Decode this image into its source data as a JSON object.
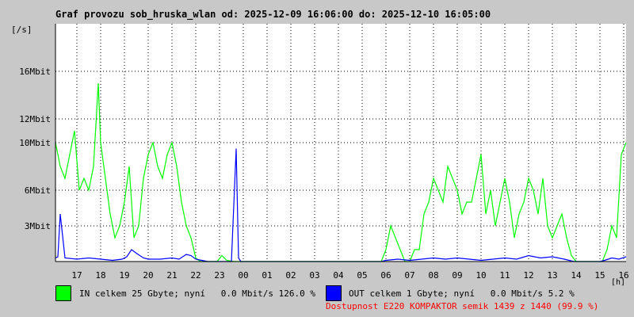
{
  "header": {
    "title": "Graf provozu sob_hruska_wlan od: 2025-12-09 16:06:00 do: 2025-12-10 16:05:00"
  },
  "axis": {
    "y_unit": "[/s]",
    "x_unit": "[h]"
  },
  "legend": {
    "in": {
      "text": "IN celkem 25 Gbyte; nyní   0.0 Mbit/s 126.0 %",
      "color": "#00ff00"
    },
    "out": {
      "text": "OUT celkem 1 Gbyte; nyní   0.0 Mbit/s 5.2 %",
      "color": "#0000ff"
    }
  },
  "availability": {
    "text": "Dostupnost E220 KOMPAKTOR semik 1439 z 1440 (99.9 %)",
    "color": "#ff0000"
  },
  "colors": {
    "plot_bg": "#ffffff",
    "grid": "#000000",
    "in": "#00ff00",
    "out": "#0000ff"
  },
  "chart_data": {
    "type": "line",
    "title": "Graf provozu sob_hruska_wlan od: 2025-12-09 16:06:00 do: 2025-12-10 16:05:00",
    "xlabel": "[h]",
    "ylabel": "[/s]",
    "xlim": [
      16.1,
      40.1
    ],
    "ylim": [
      0,
      20
    ],
    "grid": true,
    "legend_position": "bottom",
    "yticks": [
      {
        "value": 3,
        "label": "3Mbit"
      },
      {
        "value": 6,
        "label": "6Mbit"
      },
      {
        "value": 10,
        "label": "10Mbit"
      },
      {
        "value": 12,
        "label": "12Mbit"
      },
      {
        "value": 16,
        "label": "16Mbit"
      }
    ],
    "xticks": [
      {
        "value": 17,
        "label": "17"
      },
      {
        "value": 18,
        "label": "18"
      },
      {
        "value": 19,
        "label": "19"
      },
      {
        "value": 20,
        "label": "20"
      },
      {
        "value": 21,
        "label": "21"
      },
      {
        "value": 22,
        "label": "22"
      },
      {
        "value": 23,
        "label": "23"
      },
      {
        "value": 24,
        "label": "00"
      },
      {
        "value": 25,
        "label": "01"
      },
      {
        "value": 26,
        "label": "02"
      },
      {
        "value": 27,
        "label": "03"
      },
      {
        "value": 28,
        "label": "04"
      },
      {
        "value": 29,
        "label": "05"
      },
      {
        "value": 30,
        "label": "06"
      },
      {
        "value": 31,
        "label": "07"
      },
      {
        "value": 32,
        "label": "08"
      },
      {
        "value": 33,
        "label": "09"
      },
      {
        "value": 34,
        "label": "10"
      },
      {
        "value": 35,
        "label": "11"
      },
      {
        "value": 36,
        "label": "12"
      },
      {
        "value": 37,
        "label": "13"
      },
      {
        "value": 38,
        "label": "14"
      },
      {
        "value": 39,
        "label": "15"
      },
      {
        "value": 40,
        "label": "16"
      }
    ],
    "series": [
      {
        "name": "IN",
        "color": "#00ff00",
        "x": [
          16.1,
          16.3,
          16.5,
          16.7,
          16.9,
          17.1,
          17.3,
          17.5,
          17.7,
          17.9,
          18.0,
          18.2,
          18.4,
          18.6,
          18.8,
          19.0,
          19.2,
          19.4,
          19.6,
          19.8,
          20.0,
          20.2,
          20.4,
          20.6,
          20.8,
          21.0,
          21.2,
          21.4,
          21.6,
          21.8,
          22.0,
          22.2,
          22.5,
          22.9,
          23.1,
          23.3,
          23.6,
          24.0,
          24.5,
          25.0,
          25.5,
          26.0,
          26.5,
          27.0,
          27.5,
          28.0,
          28.3,
          28.6,
          29.0,
          29.5,
          29.8,
          30.0,
          30.2,
          30.4,
          30.6,
          30.8,
          31.0,
          31.2,
          31.4,
          31.6,
          31.8,
          32.0,
          32.2,
          32.4,
          32.6,
          32.8,
          33.0,
          33.2,
          33.4,
          33.6,
          33.8,
          34.0,
          34.2,
          34.4,
          34.6,
          34.8,
          35.0,
          35.2,
          35.4,
          35.6,
          35.8,
          36.0,
          36.2,
          36.4,
          36.6,
          36.8,
          37.0,
          37.2,
          37.4,
          37.6,
          37.8,
          38.0,
          38.3,
          38.6,
          38.9,
          39.1,
          39.3,
          39.5,
          39.7,
          39.9,
          40.1
        ],
        "y": [
          10,
          8,
          7,
          9,
          11,
          6,
          7,
          6,
          8,
          15,
          10,
          7,
          4,
          2,
          3,
          5,
          8,
          2,
          3,
          7,
          9,
          10,
          8,
          7,
          9,
          10,
          8,
          5,
          3,
          2,
          0.3,
          0,
          0,
          0,
          0.5,
          0.1,
          0,
          0,
          0,
          0,
          0,
          0,
          0,
          0,
          0,
          0,
          0,
          0,
          0,
          0,
          0,
          1,
          3,
          2,
          1,
          0,
          0,
          1,
          1,
          4,
          5,
          7,
          6,
          5,
          8,
          7,
          6,
          4,
          5,
          5,
          7,
          9,
          4,
          6,
          3,
          5,
          7,
          5,
          2,
          4,
          5,
          7,
          6,
          4,
          7,
          3,
          2,
          3,
          4,
          2,
          0.5,
          0,
          0,
          0,
          0,
          0,
          1,
          3,
          2,
          9,
          10
        ]
      },
      {
        "name": "OUT",
        "color": "#0000ff",
        "x": [
          16.1,
          16.2,
          16.3,
          16.5,
          17.0,
          17.5,
          18.0,
          18.5,
          18.9,
          19.1,
          19.3,
          19.5,
          19.8,
          20.0,
          20.5,
          21.0,
          21.3,
          21.6,
          21.8,
          22.0,
          22.5,
          23.0,
          23.5,
          23.7,
          23.8,
          23.9,
          24.1,
          24.5,
          25.0,
          26.0,
          27.0,
          28.0,
          29.0,
          29.8,
          30.0,
          30.5,
          31.0,
          31.5,
          32.0,
          32.5,
          33.0,
          33.5,
          34.0,
          34.5,
          35.0,
          35.5,
          36.0,
          36.5,
          37.0,
          37.5,
          37.9,
          38.2,
          38.6,
          39.0,
          39.2,
          39.5,
          39.8,
          40.1
        ],
        "y": [
          0.3,
          0.4,
          4,
          0.3,
          0.2,
          0.3,
          0.2,
          0.1,
          0.2,
          0.4,
          1,
          0.7,
          0.3,
          0.2,
          0.2,
          0.3,
          0.2,
          0.6,
          0.5,
          0.2,
          0,
          0,
          0,
          9.5,
          0.3,
          0,
          0,
          0,
          0,
          0,
          0,
          0,
          0,
          0,
          0.1,
          0.2,
          0.1,
          0.2,
          0.3,
          0.2,
          0.3,
          0.2,
          0.1,
          0.2,
          0.3,
          0.2,
          0.5,
          0.3,
          0.4,
          0.2,
          0,
          0,
          0,
          0,
          0.1,
          0.3,
          0.2,
          0.4
        ]
      }
    ]
  }
}
